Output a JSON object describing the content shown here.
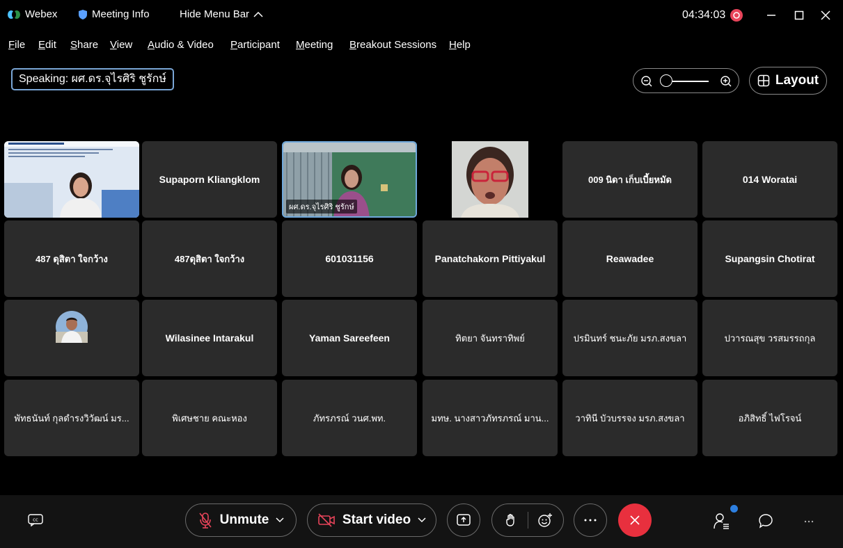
{
  "titlebar": {
    "app_name": "Webex",
    "meeting_info": "Meeting Info",
    "hide_menu_bar": "Hide Menu Bar",
    "timer": "04:34:03"
  },
  "menu": [
    "File",
    "Edit",
    "Share",
    "View",
    "Audio & Video",
    "Participant",
    "Meeting",
    "Breakout Sessions",
    "Help"
  ],
  "speaking": "Speaking: ผศ.ดร.จุไรศิริ ชูรักษ์",
  "layout_label": "Layout",
  "participants": [
    {
      "name": "",
      "type": "video-slide"
    },
    {
      "name": "Supaporn Kliangklom",
      "type": "name"
    },
    {
      "name": "ผศ.ดร.จุไรศิริ ชูรักษ์",
      "type": "video-speaker"
    },
    {
      "name": "",
      "type": "video-face"
    },
    {
      "name": "009 นิดา เก็บเบี้ยหมัด",
      "type": "name-thai"
    },
    {
      "name": "014 Woratai",
      "type": "name"
    },
    {
      "name": "487 ดุสิตา ใจกว้าง",
      "type": "name-thai"
    },
    {
      "name": "487ดุสิตา ใจกว้าง",
      "type": "name-thai"
    },
    {
      "name": "601031156",
      "type": "name"
    },
    {
      "name": "Panatchakorn Pittiyakul",
      "type": "name"
    },
    {
      "name": "Reawadee",
      "type": "name"
    },
    {
      "name": "Supangsin Chotirat",
      "type": "name"
    },
    {
      "name": "",
      "type": "avatar"
    },
    {
      "name": "Wilasinee Intarakul",
      "type": "name"
    },
    {
      "name": "Yaman Sareefeen",
      "type": "name"
    },
    {
      "name": "ทิตยา จันทราทิพย์",
      "type": "name-thai"
    },
    {
      "name": "ปรมินทร์ ชนะภัย มรภ.สงขลา",
      "type": "name-thai"
    },
    {
      "name": "ปวารณสุข วรสมรรถกุล",
      "type": "name-thai"
    },
    {
      "name": "พัทธนันท์ กุลดำรงวิวัฒน์ มร...",
      "type": "name-thai"
    },
    {
      "name": "พิเศษชาย คณะหอง",
      "type": "name-thai"
    },
    {
      "name": "ภัทรภรณ์ วนศ.พท.",
      "type": "name-thai"
    },
    {
      "name": "มทษ. นางสาวภัทรภรณ์ มาน...",
      "type": "name-thai"
    },
    {
      "name": "วาทินี บัวบรรจง มรภ.สงขลา",
      "type": "name-thai"
    },
    {
      "name": "อภิสิทธิ์ ไฟโรจน์",
      "type": "name-thai"
    }
  ],
  "controls": {
    "unmute": "Unmute",
    "start_video": "Start video"
  },
  "colors": {
    "end_call": "#e8303e",
    "speaker_border": "#6fa8dc",
    "notification_dot": "#2d7fe0",
    "record_icon": "#e8445a"
  }
}
